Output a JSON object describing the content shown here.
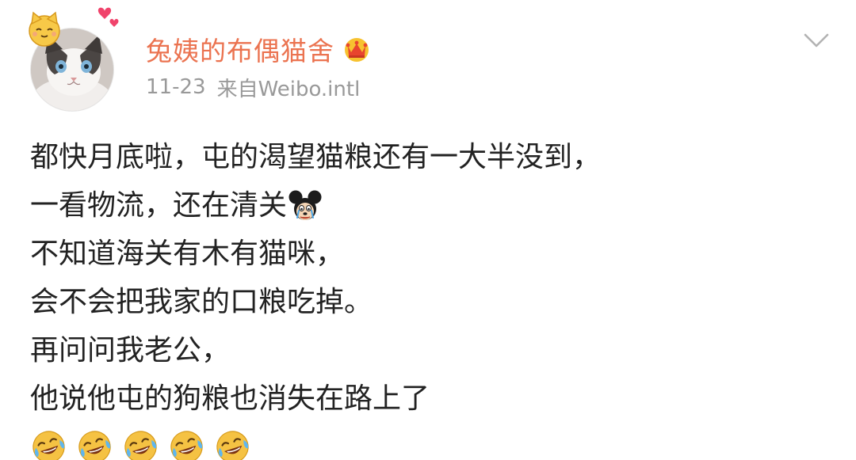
{
  "author": {
    "name": "兔姨的布偶猫舍",
    "vip_icon": "crown-vip-icon",
    "avatar": "ragdoll-cat-avatar"
  },
  "meta": {
    "date": "11-23",
    "source": "来自Weibo.intl"
  },
  "menu_icon": "chevron-down-icon",
  "post": {
    "lines": [
      "都快月底啦，屯的渴望猫粮还有一大半没到，",
      "一看物流，还在清关",
      "不知道海关有木有猫咪，",
      "会不会把我家的口粮吃掉。",
      "再问问我老公，",
      "他说他屯的狗粮也消失在路上了"
    ],
    "inline_emoji": "mickey-crying-emoji",
    "trailing_emojis": [
      "laugh-cry-emoji",
      "laugh-cry-emoji",
      "laugh-cry-emoji",
      "laugh-cry-emoji",
      "laugh-cry-emoji"
    ]
  },
  "colors": {
    "username": "#eb7350",
    "meta": "#999999",
    "text": "#222222",
    "emoji_face": "#f5c243"
  }
}
